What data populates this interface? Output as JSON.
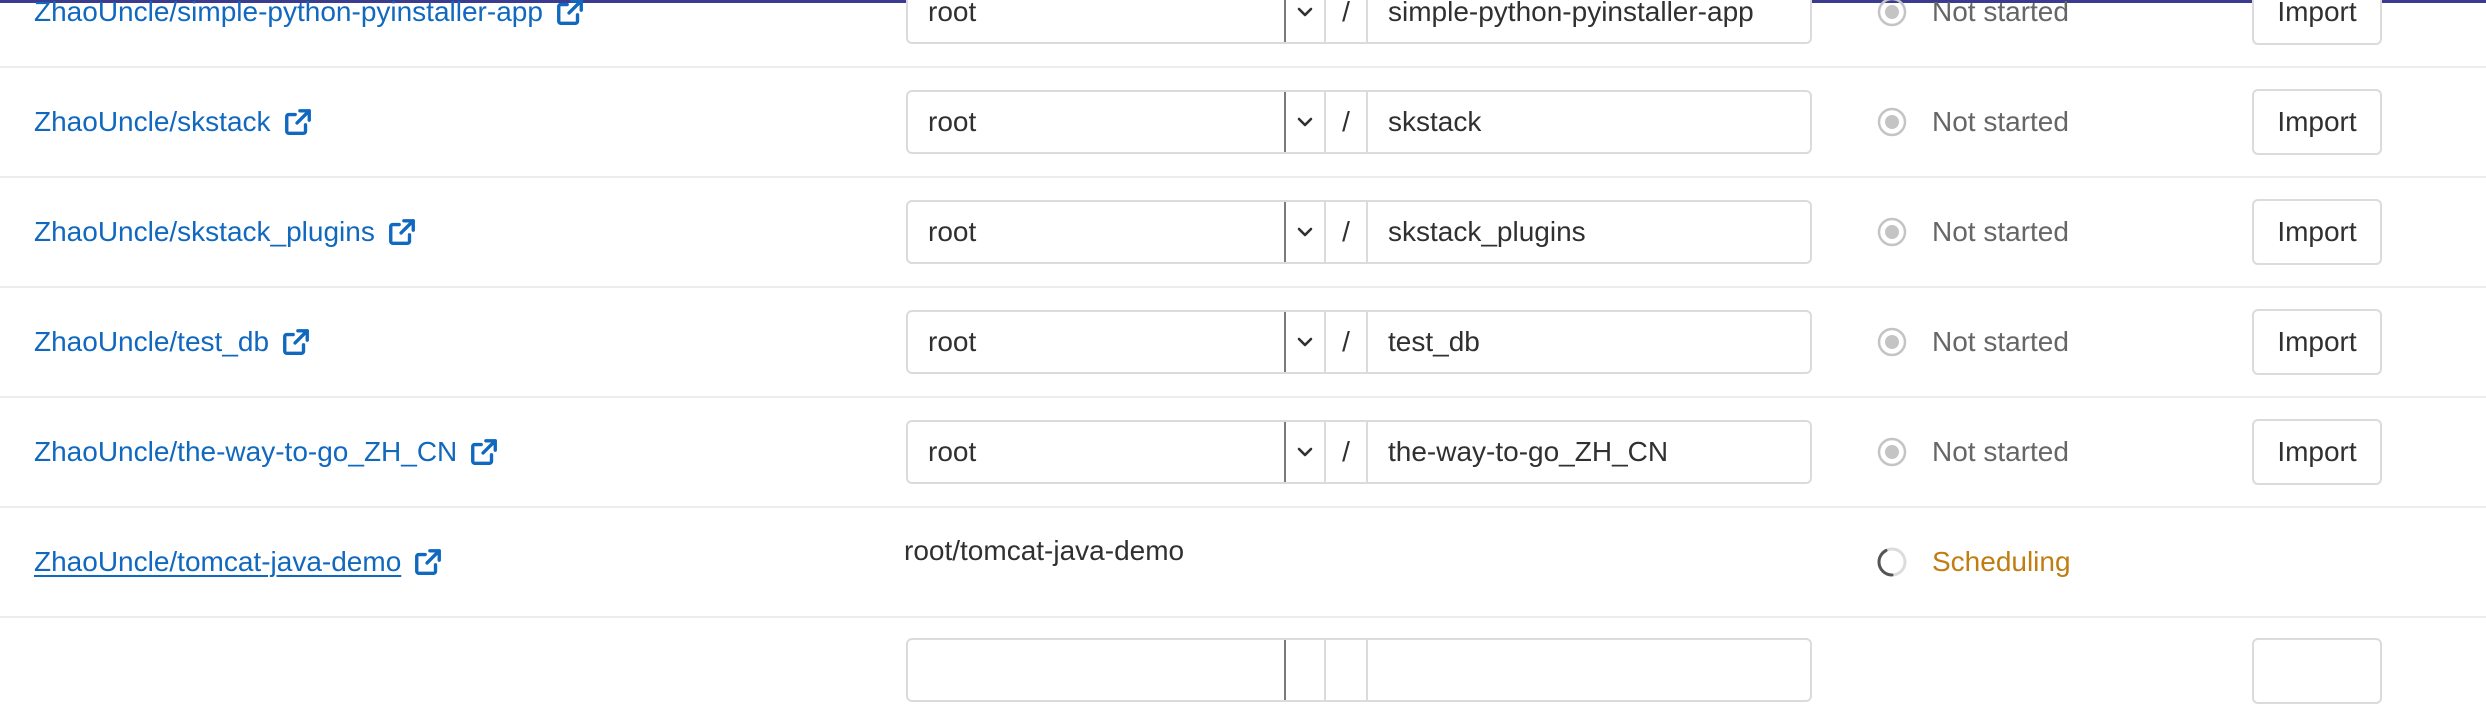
{
  "rows": [
    {
      "repo": "ZhaoUncle/simple-python-pyinstaller-app",
      "namespace": "root",
      "slash": "/",
      "name": "simple-python-pyinstaller-app",
      "status": "Not started",
      "action": "Import"
    },
    {
      "repo": "ZhaoUncle/skstack",
      "namespace": "root",
      "slash": "/",
      "name": "skstack",
      "status": "Not started",
      "action": "Import"
    },
    {
      "repo": "ZhaoUncle/skstack_plugins",
      "namespace": "root",
      "slash": "/",
      "name": "skstack_plugins",
      "status": "Not started",
      "action": "Import"
    },
    {
      "repo": "ZhaoUncle/test_db",
      "namespace": "root",
      "slash": "/",
      "name": "test_db",
      "status": "Not started",
      "action": "Import"
    },
    {
      "repo": "ZhaoUncle/the-way-to-go_ZH_CN",
      "namespace": "root",
      "slash": "/",
      "name": "the-way-to-go_ZH_CN",
      "status": "Not started",
      "action": "Import"
    },
    {
      "repo": "ZhaoUncle/tomcat-java-demo",
      "target_path": "root/tomcat-java-demo",
      "status": "Scheduling"
    }
  ],
  "colors": {
    "link": "#1068bf",
    "status_not_started": "#666666",
    "status_scheduling": "#c17d10",
    "border": "#dbdbdb"
  },
  "icons": {
    "external": "external-link-icon",
    "not_started": "radio-status-icon",
    "scheduling": "spinner-icon",
    "caret": "chevron-down-icon"
  }
}
